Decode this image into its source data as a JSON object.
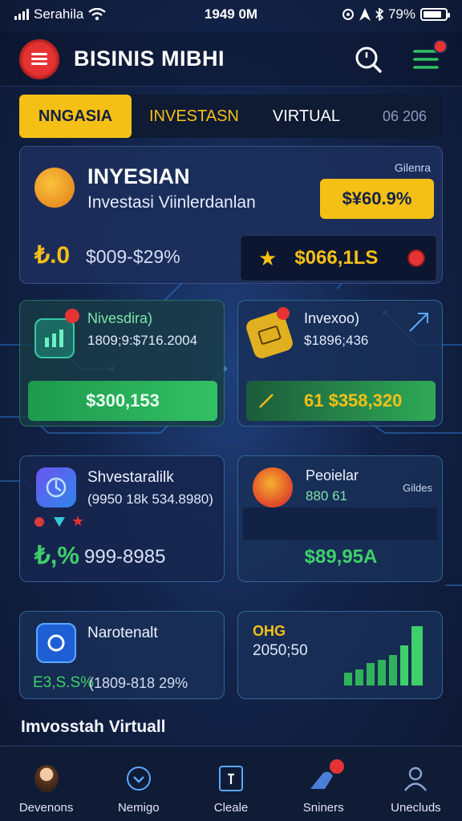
{
  "status_bar": {
    "carrier": "Serahila",
    "time": "1949 0M",
    "battery_pct": "79%"
  },
  "header": {
    "app_title": "BISINIS MIBHI"
  },
  "tabs": {
    "items": [
      {
        "label": "NNGASIA",
        "active": true
      },
      {
        "label": "INVESTASN",
        "active": false
      },
      {
        "label": "VIRTUAL",
        "active": false
      }
    ],
    "meta": "06 206"
  },
  "hero": {
    "title": "INYESIAN",
    "subtitle": "Investasi Viinlerdanlan",
    "small_label": "Gilenra",
    "badge_value": "$¥60.9%",
    "left_value": "₺.0",
    "range": "$009-$29%",
    "sub_value": "$066,1LS"
  },
  "cards": [
    {
      "name": "Nivesdira)",
      "value": "1809;9:$716.2004",
      "bar_value": "$300,153"
    },
    {
      "name": "Invexoo)",
      "value": "$1896;436",
      "bar_value": "61 $358,320"
    },
    {
      "name": "Shvestaralilk",
      "value": "(9950 18k 534.8980)",
      "big_prefix": "₺,%",
      "big_value": "999-8985"
    },
    {
      "name": "Peoielar",
      "value": "880 61",
      "small_label": "Gildes",
      "bar_value": "$89,95A"
    },
    {
      "name": "Narotenalt",
      "value": "E3,S.S%",
      "range": "(1809-818 29%"
    },
    {
      "name": "OHG",
      "value": "2050;50"
    }
  ],
  "bottom_label": "Imvosstah Virtuall",
  "nav": {
    "items": [
      {
        "label": "Devenons"
      },
      {
        "label": "Nemigo"
      },
      {
        "label": "Cleale"
      },
      {
        "label": "Sniners"
      },
      {
        "label": "Unecluds"
      }
    ]
  },
  "colors": {
    "accent_yellow": "#f5c016",
    "accent_green": "#33c064",
    "accent_red": "#e53333",
    "bg_dark": "#0c1630"
  }
}
